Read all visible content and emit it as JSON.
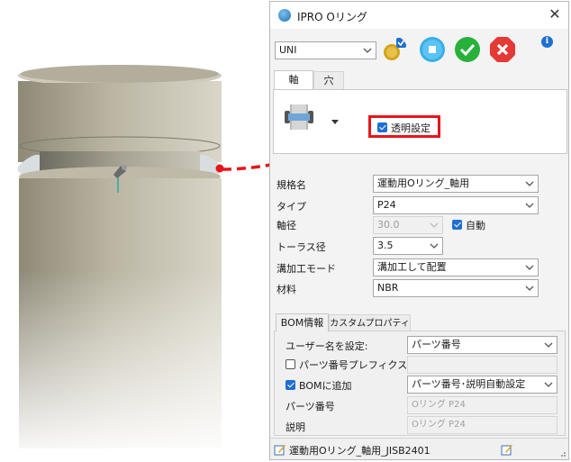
{
  "dialog": {
    "title": "IPRO Oリング",
    "template_value": "UNI"
  },
  "tabs": [
    "軸",
    "穴"
  ],
  "transparency": {
    "label": "透明設定",
    "checked": true
  },
  "props": {
    "spec_label": "規格名",
    "spec_value": "運動用Oリング_軸用",
    "type_label": "タイプ",
    "type_value": "P24",
    "shaft_label": "軸径",
    "shaft_value": "30.0",
    "auto_label": "自動",
    "auto_checked": true,
    "torus_label": "トーラス径",
    "torus_value": "3.5",
    "groove_label": "溝加工モード",
    "groove_value": "溝加工して配置",
    "material_label": "材料",
    "material_value": "NBR"
  },
  "bom_tabs": [
    "BOM情報",
    "カスタムプロパティ"
  ],
  "bom": {
    "username_label": "ユーザー名を設定:",
    "username_value": "パーツ番号",
    "prefix_label": "パーツ番号プレフィクス",
    "prefix_checked": false,
    "prefix_value": "",
    "add_label": "BOMに追加",
    "add_checked": true,
    "add_value": "パーツ番号･説明自動設定",
    "partno_label": "パーツ番号",
    "partno_value": "Oリング P24",
    "desc_label": "説明",
    "desc_value": "Oリング P24"
  },
  "status": {
    "text": "運動用Oリング_軸用_JISB2401"
  },
  "colors": {
    "accent": "#1f6fd1",
    "highlight": "#e8141a",
    "ok": "#27b13a",
    "cancel": "#e53935"
  },
  "icons": [
    "app-icon",
    "close-icon",
    "wizard-icon",
    "stop-icon",
    "check-icon",
    "cancel-icon",
    "info-icon",
    "oring-preview-icon",
    "pin-icon",
    "edit-icon"
  ]
}
